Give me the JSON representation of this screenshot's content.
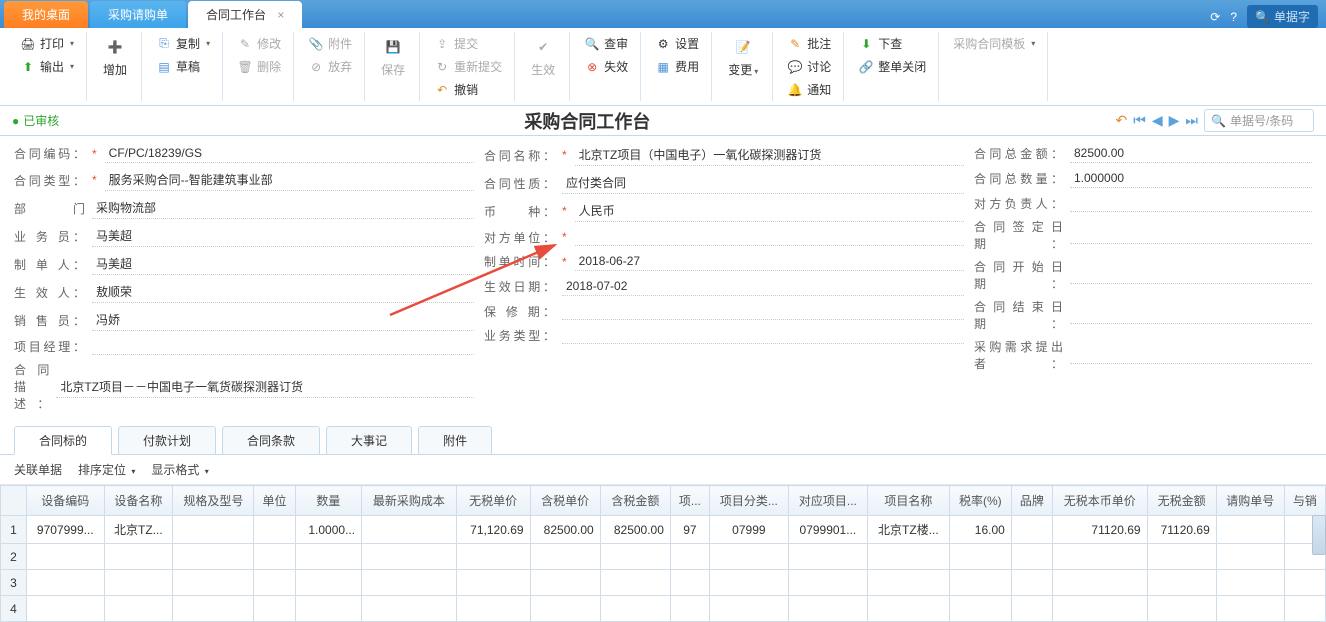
{
  "tabs": {
    "t0": "我的桌面",
    "t1": "采购请购单",
    "t2": "合同工作台"
  },
  "top_search_ph": "单据字",
  "toolbar": {
    "print": "打印",
    "output": "输出",
    "add": "增加",
    "copy": "复制",
    "draft": "草稿",
    "modify": "修改",
    "del": "删除",
    "attach": "附件",
    "shelve": "放弃",
    "save": "保存",
    "submit": "提交",
    "resubmit": "重新提交",
    "revoke": "撤销",
    "effect": "生效",
    "review": "查审",
    "invalid": "失效",
    "setting": "设置",
    "fee": "费用",
    "change": "变更",
    "approve": "批注",
    "discuss": "讨论",
    "notify": "通知",
    "check_down": "下查",
    "link_close": "整单关闭",
    "template": "采购合同模板"
  },
  "status": "已审核",
  "title": "采购合同工作台",
  "nav_search_ph": "单据号/条码",
  "form": {
    "left": {
      "contract_no_l": "合同编码：",
      "contract_no": "CF/PC/18239/GS",
      "contract_type_l": "合同类型：",
      "contract_type": "服务采购合同--智能建筑事业部",
      "dept_l": "部　　门",
      "dept": "采购物流部",
      "biz_person_l": "业 务 员：",
      "biz_person": "马美超",
      "maker_l": "制 单 人：",
      "maker": "马美超",
      "effector_l": "生 效 人：",
      "effector": "敖顺荣",
      "seller_l": "销 售 员：",
      "seller": "冯娇",
      "pm_l": "项目经理：",
      "pm": "",
      "desc_l": "合同描述：",
      "desc": "北京TZ项目－－中国电子一氧货碳探测器订货"
    },
    "mid": {
      "name_l": "合同名称：",
      "name": "北京TZ项目（中国电子）一氧化碳探测器订货",
      "nature_l": "合同性质：",
      "nature": "应付类合同",
      "currency_l": "币　　种：",
      "currency": "人民币",
      "partner_l": "对方单位：",
      "partner": "",
      "make_date_l": "制单时间：",
      "make_date": "2018-06-27",
      "eff_date_l": "生效日期：",
      "eff_date": "2018-07-02",
      "warranty_l": "保 修 期：",
      "warranty": "",
      "biz_type_l": "业务类型：",
      "biz_type": ""
    },
    "right": {
      "total_amt_l": "合同总金额：",
      "total_amt": "82500.00",
      "total_qty_l": "合同总数量：",
      "total_qty": "1.000000",
      "partner_person_l": "对方负责人：",
      "partner_person": "",
      "sign_date_l": "合同签定日期：",
      "sign_date": "",
      "start_date_l": "合同开始日期：",
      "start_date": "",
      "end_date_l": "合同结束日期：",
      "end_date": "",
      "requester_l": "采购需求提出者：",
      "requester": ""
    }
  },
  "dtabs": {
    "t0": "合同标的",
    "t1": "付款计划",
    "t2": "合同条款",
    "t3": "大事记",
    "t4": "附件"
  },
  "subbar": {
    "a": "关联单据",
    "b": "排序定位",
    "c": "显示格式"
  },
  "grid": {
    "headers": [
      "设备编码",
      "设备名称",
      "规格及型号",
      "单位",
      "数量",
      "最新采购成本",
      "无税单价",
      "含税单价",
      "含税金额",
      "项...",
      "项目分类...",
      "对应项目...",
      "项目名称",
      "税率(%)",
      "品牌",
      "无税本币单价",
      "无税金额",
      "请购单号",
      "与销"
    ],
    "rows": [
      [
        "9707999...",
        "北京TZ...",
        "",
        "",
        "1.0000...",
        "",
        "71,120.69",
        "82500.00",
        "82500.00",
        "97",
        "07999",
        "0799901...",
        "北京TZ楼...",
        "16.00",
        "",
        "71120.69",
        "71120.69",
        "",
        ""
      ],
      [
        "",
        "",
        "",
        "",
        "",
        "",
        "",
        "",
        "",
        "",
        "",
        "",
        "",
        "",
        "",
        "",
        "",
        "",
        ""
      ],
      [
        "",
        "",
        "",
        "",
        "",
        "",
        "",
        "",
        "",
        "",
        "",
        "",
        "",
        "",
        "",
        "",
        "",
        "",
        ""
      ],
      [
        "",
        "",
        "",
        "",
        "",
        "",
        "",
        "",
        "",
        "",
        "",
        "",
        "",
        "",
        "",
        "",
        "",
        "",
        ""
      ]
    ]
  }
}
